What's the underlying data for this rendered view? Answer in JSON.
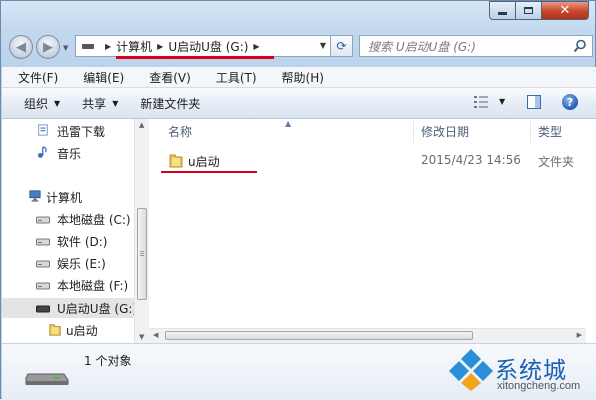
{
  "window": {
    "caption": {
      "minimize": "—",
      "maximize": "□",
      "close": "✕"
    }
  },
  "address": {
    "crumbs": [
      "计算机",
      "U启动U盘 (G:)"
    ],
    "search_placeholder": "搜索 U启动U盘 (G:)"
  },
  "menubar": [
    "文件(F)",
    "编辑(E)",
    "查看(V)",
    "工具(T)",
    "帮助(H)"
  ],
  "toolbar": {
    "organize": "组织",
    "share": "共享",
    "new_folder": "新建文件夹"
  },
  "navpane": {
    "items": [
      {
        "label": "迅雷下载",
        "icon": "thunder-download-icon"
      },
      {
        "label": "音乐",
        "icon": "music-icon"
      },
      {
        "label": "计算机",
        "icon": "computer-icon"
      },
      {
        "label": "本地磁盘 (C:)",
        "icon": "drive-icon"
      },
      {
        "label": "软件 (D:)",
        "icon": "drive-icon"
      },
      {
        "label": "娱乐 (E:)",
        "icon": "drive-icon"
      },
      {
        "label": "本地磁盘 (F:)",
        "icon": "drive-icon"
      },
      {
        "label": "U启动U盘 (G:)",
        "icon": "usb-drive-icon",
        "selected": true
      },
      {
        "label": "u启动",
        "icon": "folder-icon"
      }
    ]
  },
  "content": {
    "columns": [
      "名称",
      "修改日期",
      "类型"
    ],
    "rows": [
      {
        "name": "u启动",
        "modified": "2015/4/23 14:56",
        "type": "文件夹"
      }
    ]
  },
  "details": {
    "count": "1 个对象"
  },
  "watermark": {
    "title": "系统城",
    "url": "xitongcheng.com"
  },
  "colors": {
    "accent": "#1a5fb4",
    "annotation_red": "#d9001b"
  }
}
